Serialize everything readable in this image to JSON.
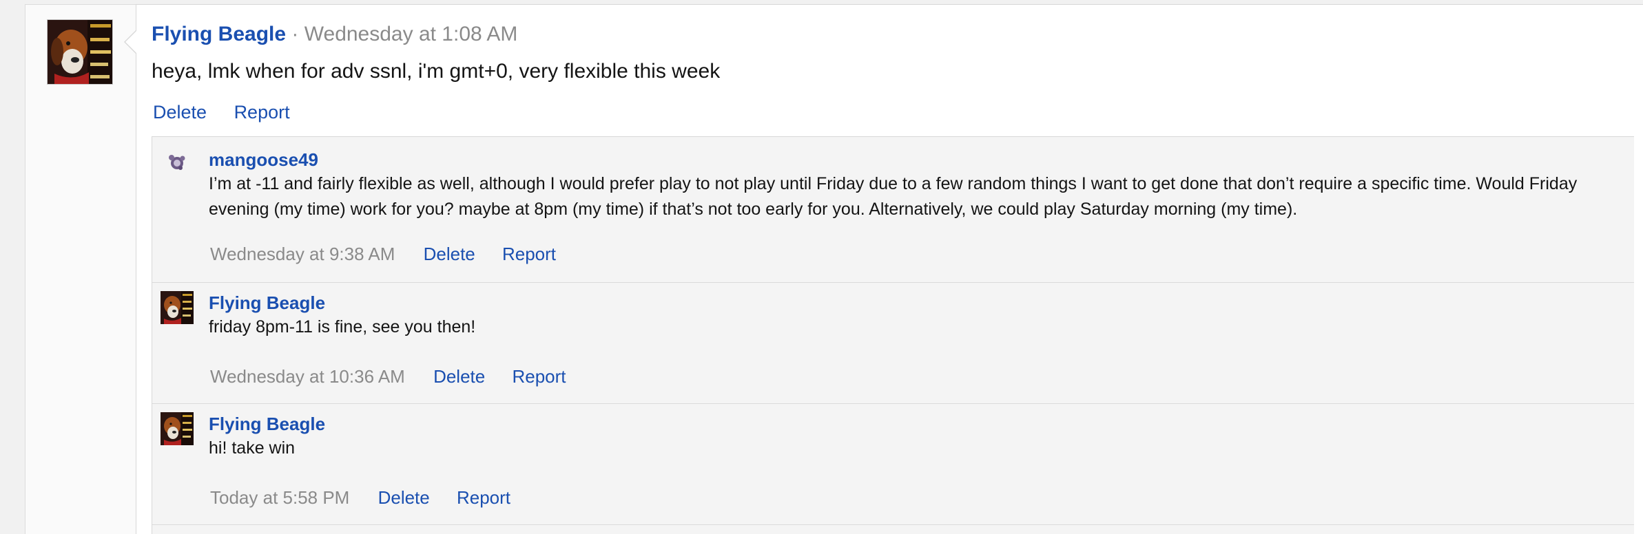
{
  "post": {
    "author": "Flying Beagle",
    "separator": "·",
    "date": "Wednesday at 1:08 AM",
    "body": "heya, lmk when for adv ssnl, i'm gmt+0, very flexible this week",
    "actions": {
      "delete": "Delete",
      "report": "Report"
    },
    "avatar_icon": "beagle-avatar-icon"
  },
  "replies": [
    {
      "author": "mangoose49",
      "avatar_icon": "mangoose-avatar-icon",
      "text": "I’m at -11 and fairly flexible as well, although I would prefer play to not play until Friday due to a few random things I want to get done that don’t require a specific time. Would Friday evening (my time) work for you? maybe at 8pm (my time) if that’s not too early for you. Alternatively, we could play Saturday morning (my time).",
      "date": "Wednesday at 9:38 AM",
      "delete": "Delete",
      "report": "Report"
    },
    {
      "author": "Flying Beagle",
      "avatar_icon": "beagle-avatar-icon",
      "text": "friday 8pm-11 is fine, see you then!",
      "date": "Wednesday at 10:36 AM",
      "delete": "Delete",
      "report": "Report"
    },
    {
      "author": "Flying Beagle",
      "avatar_icon": "beagle-avatar-icon",
      "text": "hi! take win",
      "date": "Today at 5:58 PM",
      "delete": "Delete",
      "report": "Report"
    }
  ],
  "colors": {
    "link": "#1a4fb0",
    "meta": "#8a8a8a",
    "reply_bg": "#f4f4f4"
  }
}
